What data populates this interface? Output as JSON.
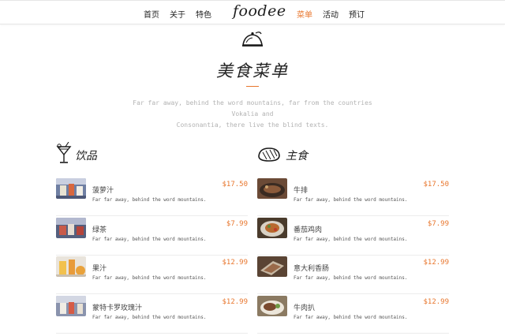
{
  "nav": {
    "links": [
      "首页",
      "关于",
      "特色"
    ],
    "brand": "foodee",
    "right_links": [
      "菜单",
      "活动",
      "预订"
    ],
    "active": "菜单"
  },
  "header": {
    "title": "美食菜单",
    "intro_line1": "Far far away, behind the word mountains, far from the countries Vokalia and",
    "intro_line2": "Consonantia, there live the blind texts."
  },
  "drinks": {
    "title": "饮品",
    "icon": "cocktail-icon",
    "items": [
      {
        "name": "菠萝汁",
        "desc": "Far far away, behind the word mountains.",
        "price": "$17.50"
      },
      {
        "name": "绿茶",
        "desc": "Far far away, behind the word mountains.",
        "price": "$7.99"
      },
      {
        "name": "果汁",
        "desc": "Far far away, behind the word mountains.",
        "price": "$12.99"
      },
      {
        "name": "蒙特卡罗玫瑰汁",
        "desc": "Far far away, behind the word mountains.",
        "price": "$12.99"
      }
    ]
  },
  "mains": {
    "title": "主食",
    "icon": "meat-icon",
    "items": [
      {
        "name": "牛排",
        "desc": "Far far away, behind the word mountains.",
        "price": "$17.50"
      },
      {
        "name": "番茄鸡肉",
        "desc": "Far far away, behind the word mountains.",
        "price": "$7.99"
      },
      {
        "name": "意大利香肠",
        "desc": "Far far away, behind the word mountains.",
        "price": "$12.99"
      },
      {
        "name": "牛肉扒",
        "desc": "Far far away, behind the word mountains.",
        "price": "$12.99"
      }
    ]
  },
  "colors": {
    "accent": "#e8762d",
    "text": "#222222",
    "muted": "#b3b3b3",
    "divider": "#ececec"
  }
}
